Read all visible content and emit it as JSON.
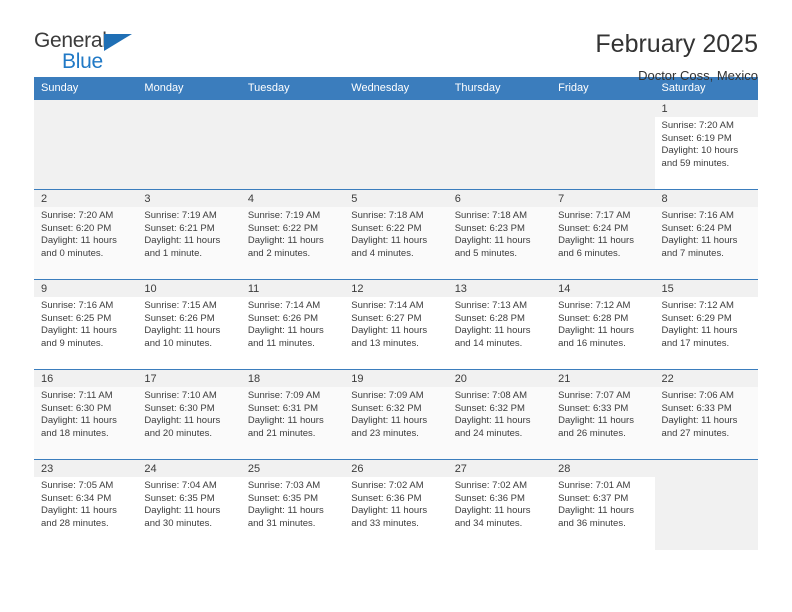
{
  "brand": {
    "name_top": "General",
    "name_bottom": "Blue",
    "accent_color": "#2079c6",
    "triangle_color": "#1f6fb5"
  },
  "header": {
    "title": "February 2025",
    "subtitle": "Doctor Coss, Mexico"
  },
  "colors": {
    "header_row_bg": "#3b7dbd",
    "header_row_text": "#ffffff",
    "daynum_bg": "#f1f1f1",
    "row_border": "#3b7dbd",
    "shaded_row_bg": "#fafafa",
    "text": "#3c3c3c"
  },
  "weekdays": [
    "Sunday",
    "Monday",
    "Tuesday",
    "Wednesday",
    "Thursday",
    "Friday",
    "Saturday"
  ],
  "labels": {
    "sunrise": "Sunrise:",
    "sunset": "Sunset:",
    "daylight": "Daylight:"
  },
  "weeks": [
    {
      "shaded": false,
      "days": [
        {
          "empty": true
        },
        {
          "empty": true
        },
        {
          "empty": true
        },
        {
          "empty": true
        },
        {
          "empty": true
        },
        {
          "empty": true
        },
        {
          "empty": false,
          "date": "1",
          "sunrise": "Sunrise: 7:20 AM",
          "sunset": "Sunset: 6:19 PM",
          "daylight": "Daylight: 10 hours and 59 minutes."
        }
      ]
    },
    {
      "shaded": true,
      "days": [
        {
          "empty": false,
          "date": "2",
          "sunrise": "Sunrise: 7:20 AM",
          "sunset": "Sunset: 6:20 PM",
          "daylight": "Daylight: 11 hours and 0 minutes."
        },
        {
          "empty": false,
          "date": "3",
          "sunrise": "Sunrise: 7:19 AM",
          "sunset": "Sunset: 6:21 PM",
          "daylight": "Daylight: 11 hours and 1 minute."
        },
        {
          "empty": false,
          "date": "4",
          "sunrise": "Sunrise: 7:19 AM",
          "sunset": "Sunset: 6:22 PM",
          "daylight": "Daylight: 11 hours and 2 minutes."
        },
        {
          "empty": false,
          "date": "5",
          "sunrise": "Sunrise: 7:18 AM",
          "sunset": "Sunset: 6:22 PM",
          "daylight": "Daylight: 11 hours and 4 minutes."
        },
        {
          "empty": false,
          "date": "6",
          "sunrise": "Sunrise: 7:18 AM",
          "sunset": "Sunset: 6:23 PM",
          "daylight": "Daylight: 11 hours and 5 minutes."
        },
        {
          "empty": false,
          "date": "7",
          "sunrise": "Sunrise: 7:17 AM",
          "sunset": "Sunset: 6:24 PM",
          "daylight": "Daylight: 11 hours and 6 minutes."
        },
        {
          "empty": false,
          "date": "8",
          "sunrise": "Sunrise: 7:16 AM",
          "sunset": "Sunset: 6:24 PM",
          "daylight": "Daylight: 11 hours and 7 minutes."
        }
      ]
    },
    {
      "shaded": false,
      "days": [
        {
          "empty": false,
          "date": "9",
          "sunrise": "Sunrise: 7:16 AM",
          "sunset": "Sunset: 6:25 PM",
          "daylight": "Daylight: 11 hours and 9 minutes."
        },
        {
          "empty": false,
          "date": "10",
          "sunrise": "Sunrise: 7:15 AM",
          "sunset": "Sunset: 6:26 PM",
          "daylight": "Daylight: 11 hours and 10 minutes."
        },
        {
          "empty": false,
          "date": "11",
          "sunrise": "Sunrise: 7:14 AM",
          "sunset": "Sunset: 6:26 PM",
          "daylight": "Daylight: 11 hours and 11 minutes."
        },
        {
          "empty": false,
          "date": "12",
          "sunrise": "Sunrise: 7:14 AM",
          "sunset": "Sunset: 6:27 PM",
          "daylight": "Daylight: 11 hours and 13 minutes."
        },
        {
          "empty": false,
          "date": "13",
          "sunrise": "Sunrise: 7:13 AM",
          "sunset": "Sunset: 6:28 PM",
          "daylight": "Daylight: 11 hours and 14 minutes."
        },
        {
          "empty": false,
          "date": "14",
          "sunrise": "Sunrise: 7:12 AM",
          "sunset": "Sunset: 6:28 PM",
          "daylight": "Daylight: 11 hours and 16 minutes."
        },
        {
          "empty": false,
          "date": "15",
          "sunrise": "Sunrise: 7:12 AM",
          "sunset": "Sunset: 6:29 PM",
          "daylight": "Daylight: 11 hours and 17 minutes."
        }
      ]
    },
    {
      "shaded": true,
      "days": [
        {
          "empty": false,
          "date": "16",
          "sunrise": "Sunrise: 7:11 AM",
          "sunset": "Sunset: 6:30 PM",
          "daylight": "Daylight: 11 hours and 18 minutes."
        },
        {
          "empty": false,
          "date": "17",
          "sunrise": "Sunrise: 7:10 AM",
          "sunset": "Sunset: 6:30 PM",
          "daylight": "Daylight: 11 hours and 20 minutes."
        },
        {
          "empty": false,
          "date": "18",
          "sunrise": "Sunrise: 7:09 AM",
          "sunset": "Sunset: 6:31 PM",
          "daylight": "Daylight: 11 hours and 21 minutes."
        },
        {
          "empty": false,
          "date": "19",
          "sunrise": "Sunrise: 7:09 AM",
          "sunset": "Sunset: 6:32 PM",
          "daylight": "Daylight: 11 hours and 23 minutes."
        },
        {
          "empty": false,
          "date": "20",
          "sunrise": "Sunrise: 7:08 AM",
          "sunset": "Sunset: 6:32 PM",
          "daylight": "Daylight: 11 hours and 24 minutes."
        },
        {
          "empty": false,
          "date": "21",
          "sunrise": "Sunrise: 7:07 AM",
          "sunset": "Sunset: 6:33 PM",
          "daylight": "Daylight: 11 hours and 26 minutes."
        },
        {
          "empty": false,
          "date": "22",
          "sunrise": "Sunrise: 7:06 AM",
          "sunset": "Sunset: 6:33 PM",
          "daylight": "Daylight: 11 hours and 27 minutes."
        }
      ]
    },
    {
      "shaded": false,
      "days": [
        {
          "empty": false,
          "date": "23",
          "sunrise": "Sunrise: 7:05 AM",
          "sunset": "Sunset: 6:34 PM",
          "daylight": "Daylight: 11 hours and 28 minutes."
        },
        {
          "empty": false,
          "date": "24",
          "sunrise": "Sunrise: 7:04 AM",
          "sunset": "Sunset: 6:35 PM",
          "daylight": "Daylight: 11 hours and 30 minutes."
        },
        {
          "empty": false,
          "date": "25",
          "sunrise": "Sunrise: 7:03 AM",
          "sunset": "Sunset: 6:35 PM",
          "daylight": "Daylight: 11 hours and 31 minutes."
        },
        {
          "empty": false,
          "date": "26",
          "sunrise": "Sunrise: 7:02 AM",
          "sunset": "Sunset: 6:36 PM",
          "daylight": "Daylight: 11 hours and 33 minutes."
        },
        {
          "empty": false,
          "date": "27",
          "sunrise": "Sunrise: 7:02 AM",
          "sunset": "Sunset: 6:36 PM",
          "daylight": "Daylight: 11 hours and 34 minutes."
        },
        {
          "empty": false,
          "date": "28",
          "sunrise": "Sunrise: 7:01 AM",
          "sunset": "Sunset: 6:37 PM",
          "daylight": "Daylight: 11 hours and 36 minutes."
        },
        {
          "empty": true
        }
      ]
    }
  ]
}
